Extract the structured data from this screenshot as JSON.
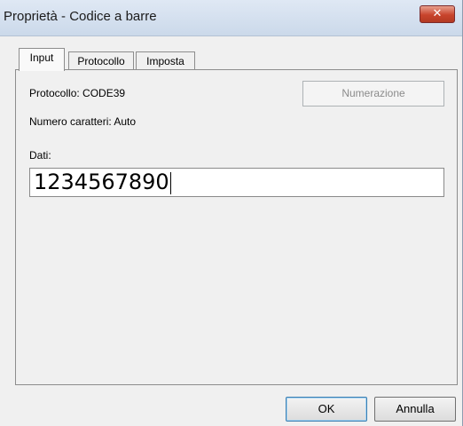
{
  "window": {
    "title": "Proprietà - Codice a barre",
    "close_glyph": "✕"
  },
  "tabs": [
    {
      "label": "Input",
      "active": true
    },
    {
      "label": "Protocollo",
      "active": false
    },
    {
      "label": "Imposta",
      "active": false
    }
  ],
  "input_tab": {
    "protocol_label": "Protocollo: CODE39",
    "char_count_label": "Numero caratteri: Auto",
    "numbering_button": "Numerazione",
    "data_label": "Dati:",
    "data_value": "1234567890"
  },
  "footer": {
    "ok_label": "OK",
    "cancel_label": "Annulla"
  }
}
